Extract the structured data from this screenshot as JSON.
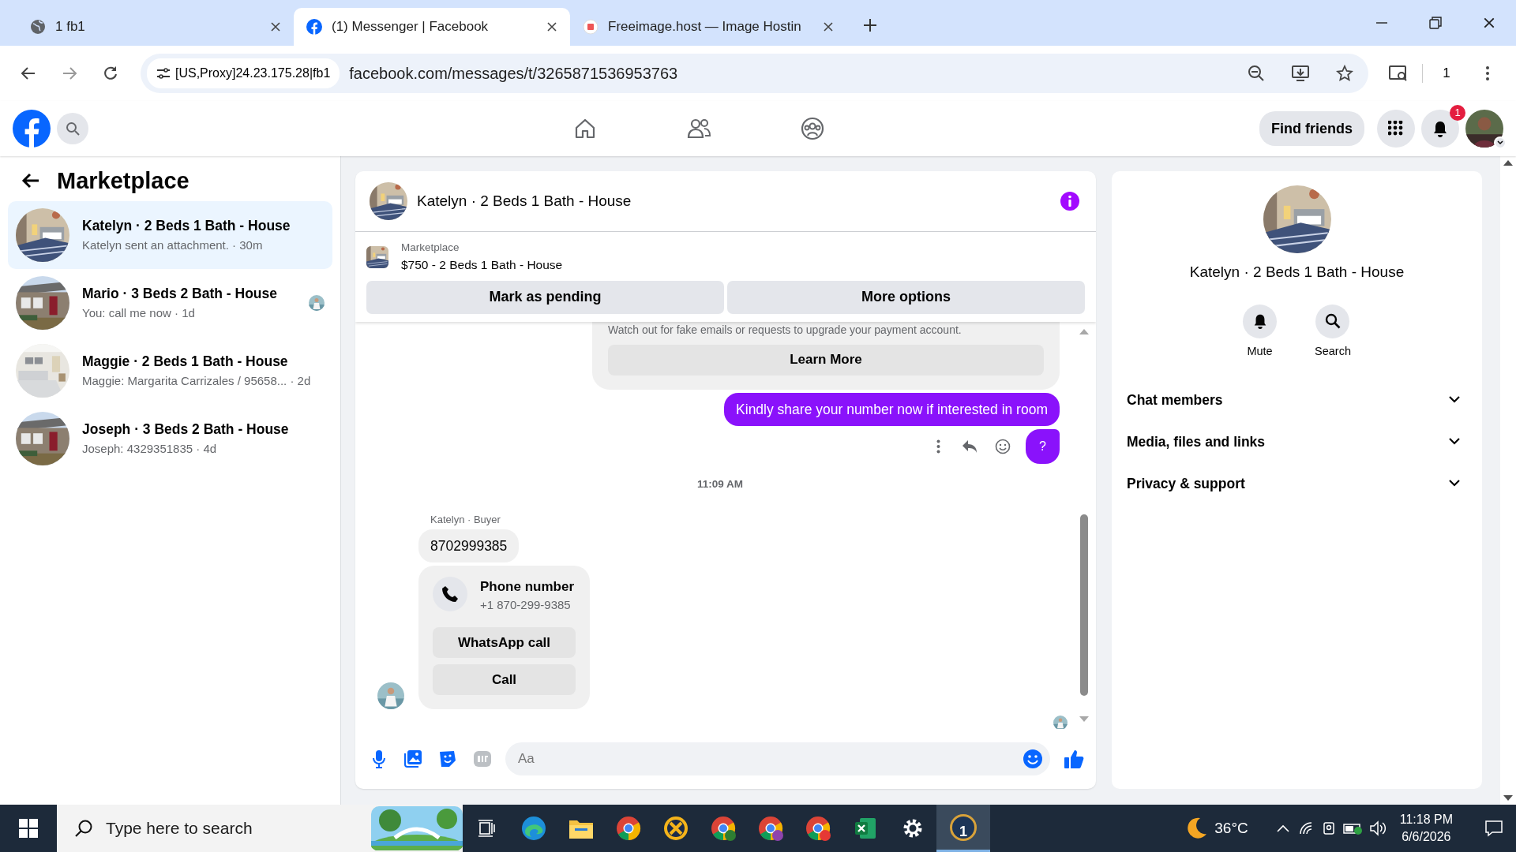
{
  "browser": {
    "tabs": [
      {
        "title": "1 fb1",
        "kind": "globe",
        "selected": false
      },
      {
        "title": "(1) Messenger | Facebook",
        "kind": "facebook",
        "selected": true
      },
      {
        "title": "Freeimage.host — Image Hostin",
        "kind": "freeimage",
        "selected": false
      }
    ],
    "proxy_chip": "[US,Proxy]24.23.175.28|fb1",
    "url": "facebook.com/messages/t/3265871536953763",
    "toolbar_count": "1"
  },
  "header": {
    "find_friends": "Find friends",
    "notification_count": "1"
  },
  "sidebar": {
    "title": "Marketplace",
    "conversations": [
      {
        "title": "Katelyn · 2 Beds 1 Bath - House",
        "preview": "Katelyn sent an attachment. · 30m",
        "selected": true,
        "seen": false
      },
      {
        "title": "Mario · 3 Beds 2 Bath - House",
        "preview": "You: call me now · 1d",
        "selected": false,
        "seen": true
      },
      {
        "title": "Maggie · 2 Beds 1 Bath - House",
        "preview": "Maggie: Margarita Carrizales / 95658... · 2d",
        "selected": false,
        "seen": false
      },
      {
        "title": "Joseph · 3 Beds 2 Bath - House",
        "preview": "Joseph: 4329351835 · 4d",
        "selected": false,
        "seen": false
      }
    ]
  },
  "chat": {
    "title": "Katelyn · 2 Beds 1 Bath - House",
    "listing": {
      "label": "Marketplace",
      "text": "$750 - 2 Beds 1 Bath - House"
    },
    "actions": [
      "Mark as pending",
      "More options"
    ],
    "messages": [
      {
        "kind": "notice",
        "text": "Watch out for fake emails or requests to upgrade your payment account.",
        "button": "Learn More"
      },
      {
        "kind": "outgoing",
        "text": "Kindly share your number now if interested in room",
        "hover": false
      },
      {
        "kind": "outgoing",
        "text": "?",
        "hover": true
      },
      {
        "kind": "time",
        "text": "11:09 AM"
      },
      {
        "kind": "incoming",
        "sender": "Katelyn · Buyer",
        "text": "8702999385"
      },
      {
        "kind": "contact",
        "title": "Phone number",
        "phone": "+1 870-299-9385",
        "buttons": [
          "WhatsApp call",
          "Call"
        ]
      }
    ],
    "composer": {
      "placeholder": "Aa"
    }
  },
  "details": {
    "title": "Katelyn · 2 Beds 1 Bath - House",
    "actions": [
      {
        "label": "Mute",
        "kind": "mute"
      },
      {
        "label": "Search",
        "kind": "search"
      }
    ],
    "sections": [
      {
        "label": "Chat members",
        "expanded": false
      },
      {
        "label": "Media, files and links",
        "expanded": false
      },
      {
        "label": "Privacy & support",
        "expanded": false
      }
    ]
  },
  "taskbar": {
    "search": {
      "placeholder": "Type here to search"
    },
    "app_badge": "1",
    "temperature": "36°C",
    "time": "11:18 PM",
    "date": "6/6/2026"
  }
}
